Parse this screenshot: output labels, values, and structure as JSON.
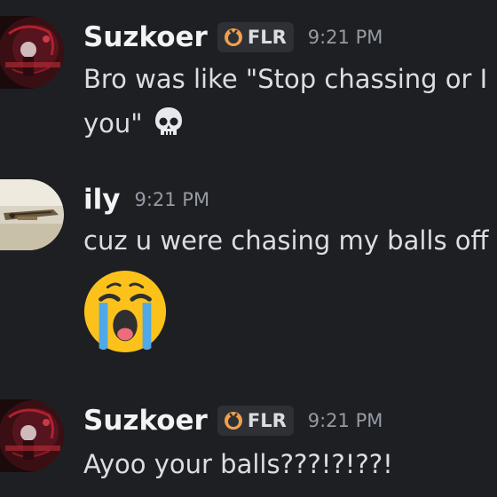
{
  "messages": [
    {
      "username": "Suzkoer",
      "tag": "FLR",
      "time": "9:21 PM",
      "line1": "Bro was like \"Stop chassing or I",
      "line2": "you\"",
      "emoji": "skull-icon"
    },
    {
      "username": "ily",
      "time": "9:21 PM",
      "line1": "cuz u were chasing my balls off",
      "emoji": "loudly-crying-face-icon"
    },
    {
      "username": "Suzkoer",
      "tag": "FLR",
      "time": "9:21 PM",
      "line1": "Ayoo your balls???!?!??!"
    }
  ],
  "colors": {
    "background": "#1e1f22",
    "username": "#f2f3f5",
    "message_text": "#dbdee1",
    "timestamp": "#949ba4",
    "tag_background": "#2e3036",
    "tag_icon": "#f0a04b"
  }
}
